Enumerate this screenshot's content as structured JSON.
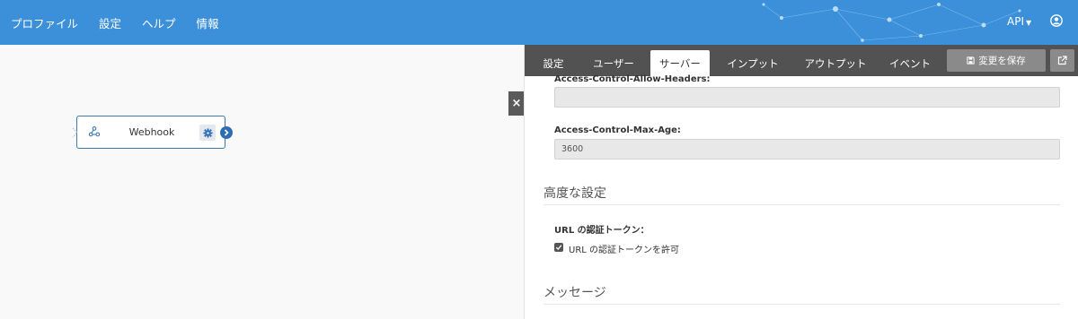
{
  "nav": {
    "items": [
      "プロファイル",
      "設定",
      "ヘルプ",
      "情報"
    ],
    "api_label": "API",
    "user_icon": "user-circle-icon"
  },
  "canvas": {
    "node": {
      "label": "Webhook",
      "icon": "webhook-icon",
      "settings_icon": "gear-icon",
      "output_icon": "chevron-right-icon"
    },
    "close_label": "×"
  },
  "panel": {
    "tabs": [
      "設定",
      "ユーザー",
      "サーバー",
      "インプット",
      "アウトプット",
      "イベント"
    ],
    "active_tab": "サーバー",
    "save_label": "変更を保存",
    "save_icon": "floppy-disk-icon",
    "external_icon": "external-link-icon",
    "fields": {
      "allow_headers": {
        "label": "Access-Control-Allow-Headers:",
        "value": ""
      },
      "max_age": {
        "label": "Access-Control-Max-Age:",
        "value": "3600"
      }
    },
    "advanced": {
      "title": "高度な設定",
      "url_token_label": "URL の認証トークン：",
      "url_token_checkbox_label": "URL の認証トークンを許可",
      "url_token_checked": true
    },
    "messages_title": "メッセージ"
  },
  "colors": {
    "topbar": "#3b90d9",
    "tabbar": "#525252",
    "node_border": "#3c78b4",
    "port": "#2d6db5"
  }
}
